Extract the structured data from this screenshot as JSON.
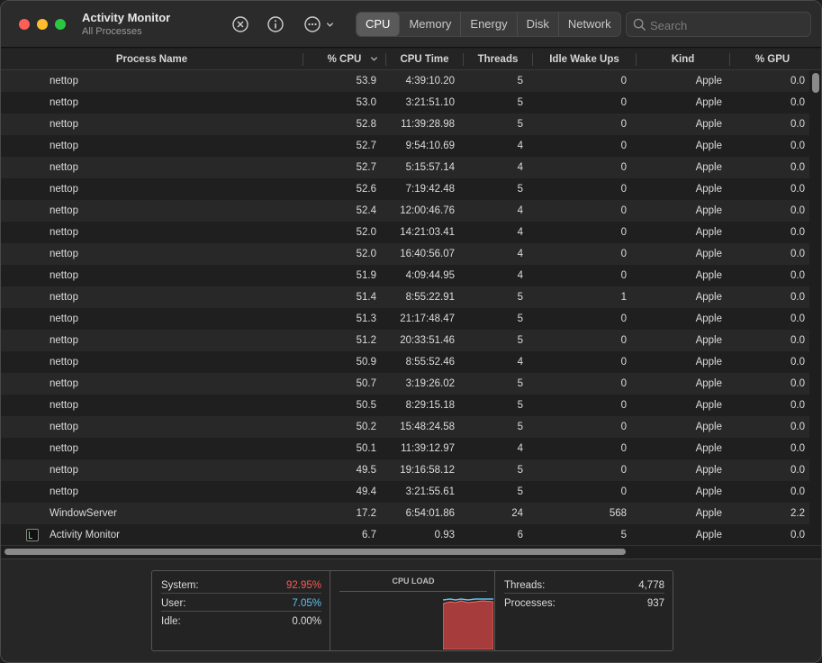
{
  "window": {
    "title": "Activity Monitor",
    "subtitle": "All Processes"
  },
  "toolbar": {
    "stop_icon": "x-circle-icon",
    "info_icon": "info-icon",
    "more_icon": "ellipsis-circle-icon",
    "tabs": [
      {
        "label": "CPU",
        "active": true
      },
      {
        "label": "Memory",
        "active": false
      },
      {
        "label": "Energy",
        "active": false
      },
      {
        "label": "Disk",
        "active": false
      },
      {
        "label": "Network",
        "active": false
      }
    ],
    "search_placeholder": "Search"
  },
  "table": {
    "columns": [
      "Process Name",
      "% CPU",
      "CPU Time",
      "Threads",
      "Idle Wake Ups",
      "Kind",
      "% GPU"
    ],
    "sorted_column": "% CPU",
    "rows": [
      {
        "name": "nettop",
        "cpu": "53.9",
        "time": "4:39:10.20",
        "threads": "5",
        "idle": "0",
        "kind": "Apple",
        "gpu": "0.0"
      },
      {
        "name": "nettop",
        "cpu": "53.0",
        "time": "3:21:51.10",
        "threads": "5",
        "idle": "0",
        "kind": "Apple",
        "gpu": "0.0"
      },
      {
        "name": "nettop",
        "cpu": "52.8",
        "time": "11:39:28.98",
        "threads": "5",
        "idle": "0",
        "kind": "Apple",
        "gpu": "0.0"
      },
      {
        "name": "nettop",
        "cpu": "52.7",
        "time": "9:54:10.69",
        "threads": "4",
        "idle": "0",
        "kind": "Apple",
        "gpu": "0.0"
      },
      {
        "name": "nettop",
        "cpu": "52.7",
        "time": "5:15:57.14",
        "threads": "4",
        "idle": "0",
        "kind": "Apple",
        "gpu": "0.0"
      },
      {
        "name": "nettop",
        "cpu": "52.6",
        "time": "7:19:42.48",
        "threads": "5",
        "idle": "0",
        "kind": "Apple",
        "gpu": "0.0"
      },
      {
        "name": "nettop",
        "cpu": "52.4",
        "time": "12:00:46.76",
        "threads": "4",
        "idle": "0",
        "kind": "Apple",
        "gpu": "0.0"
      },
      {
        "name": "nettop",
        "cpu": "52.0",
        "time": "14:21:03.41",
        "threads": "4",
        "idle": "0",
        "kind": "Apple",
        "gpu": "0.0"
      },
      {
        "name": "nettop",
        "cpu": "52.0",
        "time": "16:40:56.07",
        "threads": "4",
        "idle": "0",
        "kind": "Apple",
        "gpu": "0.0"
      },
      {
        "name": "nettop",
        "cpu": "51.9",
        "time": "4:09:44.95",
        "threads": "4",
        "idle": "0",
        "kind": "Apple",
        "gpu": "0.0"
      },
      {
        "name": "nettop",
        "cpu": "51.4",
        "time": "8:55:22.91",
        "threads": "5",
        "idle": "1",
        "kind": "Apple",
        "gpu": "0.0"
      },
      {
        "name": "nettop",
        "cpu": "51.3",
        "time": "21:17:48.47",
        "threads": "5",
        "idle": "0",
        "kind": "Apple",
        "gpu": "0.0"
      },
      {
        "name": "nettop",
        "cpu": "51.2",
        "time": "20:33:51.46",
        "threads": "5",
        "idle": "0",
        "kind": "Apple",
        "gpu": "0.0"
      },
      {
        "name": "nettop",
        "cpu": "50.9",
        "time": "8:55:52.46",
        "threads": "4",
        "idle": "0",
        "kind": "Apple",
        "gpu": "0.0"
      },
      {
        "name": "nettop",
        "cpu": "50.7",
        "time": "3:19:26.02",
        "threads": "5",
        "idle": "0",
        "kind": "Apple",
        "gpu": "0.0"
      },
      {
        "name": "nettop",
        "cpu": "50.5",
        "time": "8:29:15.18",
        "threads": "5",
        "idle": "0",
        "kind": "Apple",
        "gpu": "0.0"
      },
      {
        "name": "nettop",
        "cpu": "50.2",
        "time": "15:48:24.58",
        "threads": "5",
        "idle": "0",
        "kind": "Apple",
        "gpu": "0.0"
      },
      {
        "name": "nettop",
        "cpu": "50.1",
        "time": "11:39:12.97",
        "threads": "4",
        "idle": "0",
        "kind": "Apple",
        "gpu": "0.0"
      },
      {
        "name": "nettop",
        "cpu": "49.5",
        "time": "19:16:58.12",
        "threads": "5",
        "idle": "0",
        "kind": "Apple",
        "gpu": "0.0"
      },
      {
        "name": "nettop",
        "cpu": "49.4",
        "time": "3:21:55.61",
        "threads": "5",
        "idle": "0",
        "kind": "Apple",
        "gpu": "0.0"
      },
      {
        "name": "WindowServer",
        "cpu": "17.2",
        "time": "6:54:01.86",
        "threads": "24",
        "idle": "568",
        "kind": "Apple",
        "gpu": "2.2"
      },
      {
        "name": "Activity Monitor",
        "cpu": "6.7",
        "time": "0.93",
        "threads": "6",
        "idle": "5",
        "kind": "Apple",
        "gpu": "0.0",
        "has_icon": true
      }
    ]
  },
  "summary": {
    "system_label": "System:",
    "system_value": "92.95%",
    "user_label": "User:",
    "user_value": "7.05%",
    "idle_label": "Idle:",
    "idle_value": "0.00%",
    "cpu_load_title": "CPU LOAD",
    "threads_label": "Threads:",
    "threads_value": "4,778",
    "processes_label": "Processes:",
    "processes_value": "937"
  },
  "colors": {
    "system": "#ff5a52",
    "user": "#5ec4f2",
    "accent_tab": "#5a5a5a"
  }
}
